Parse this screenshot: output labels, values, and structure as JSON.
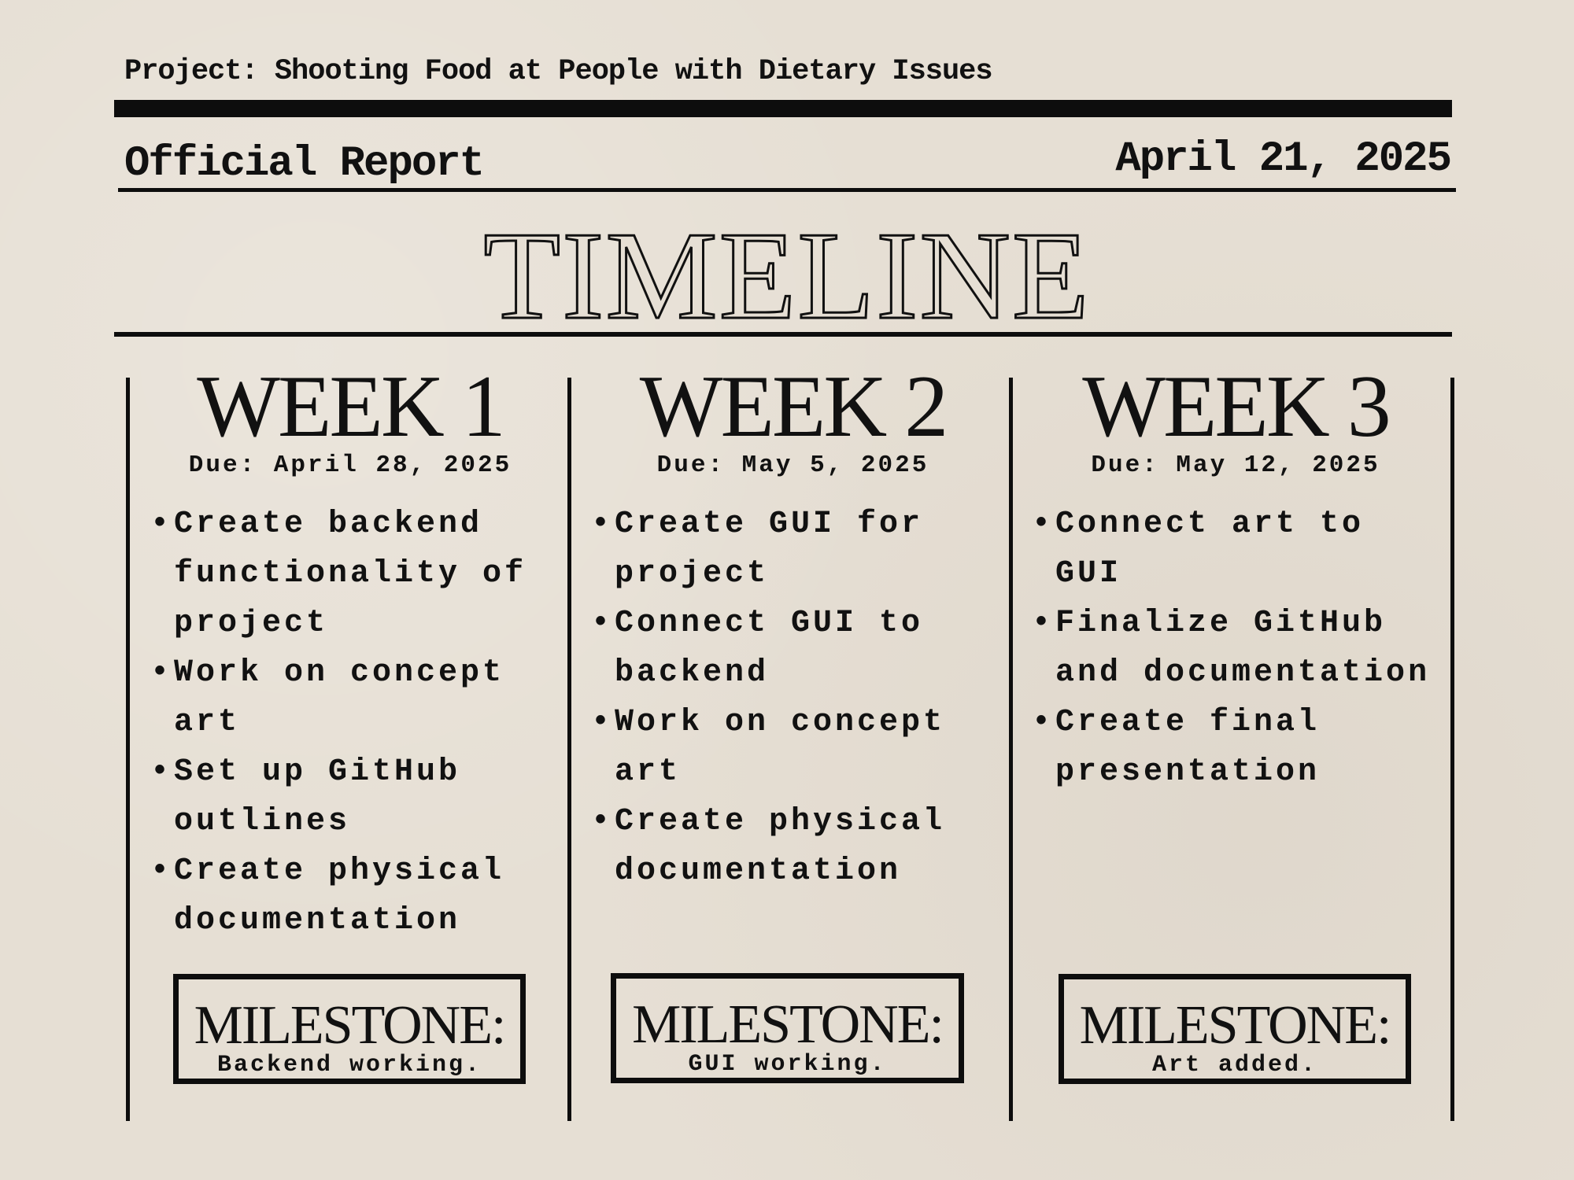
{
  "header": {
    "project": "Project: Shooting Food at People with Dietary Issues",
    "report_label": "Official Report",
    "date": "April 21, 2025"
  },
  "title": "TIMELINE",
  "weeks": [
    {
      "title": "WEEK 1",
      "due": "Due: April 28, 2025",
      "tasks": [
        "Create backend functionality of project",
        "Work on concept art",
        "Set up GitHub outlines",
        "Create physical documentation"
      ],
      "milestone_label": "MILESTONE:",
      "milestone_text": "Backend working."
    },
    {
      "title": "WEEK 2",
      "due": "Due: May 5, 2025",
      "tasks": [
        "Create GUI for project",
        "Connect GUI to backend",
        "Work on concept art",
        "Create physical documentation"
      ],
      "milestone_label": "MILESTONE:",
      "milestone_text": "GUI working."
    },
    {
      "title": "WEEK 3",
      "due": "Due: May 12, 2025",
      "tasks": [
        "Connect art to GUI",
        "Finalize GitHub and documentation",
        "Create final presentation"
      ],
      "milestone_label": "MILESTONE:",
      "milestone_text": "Art added."
    }
  ]
}
